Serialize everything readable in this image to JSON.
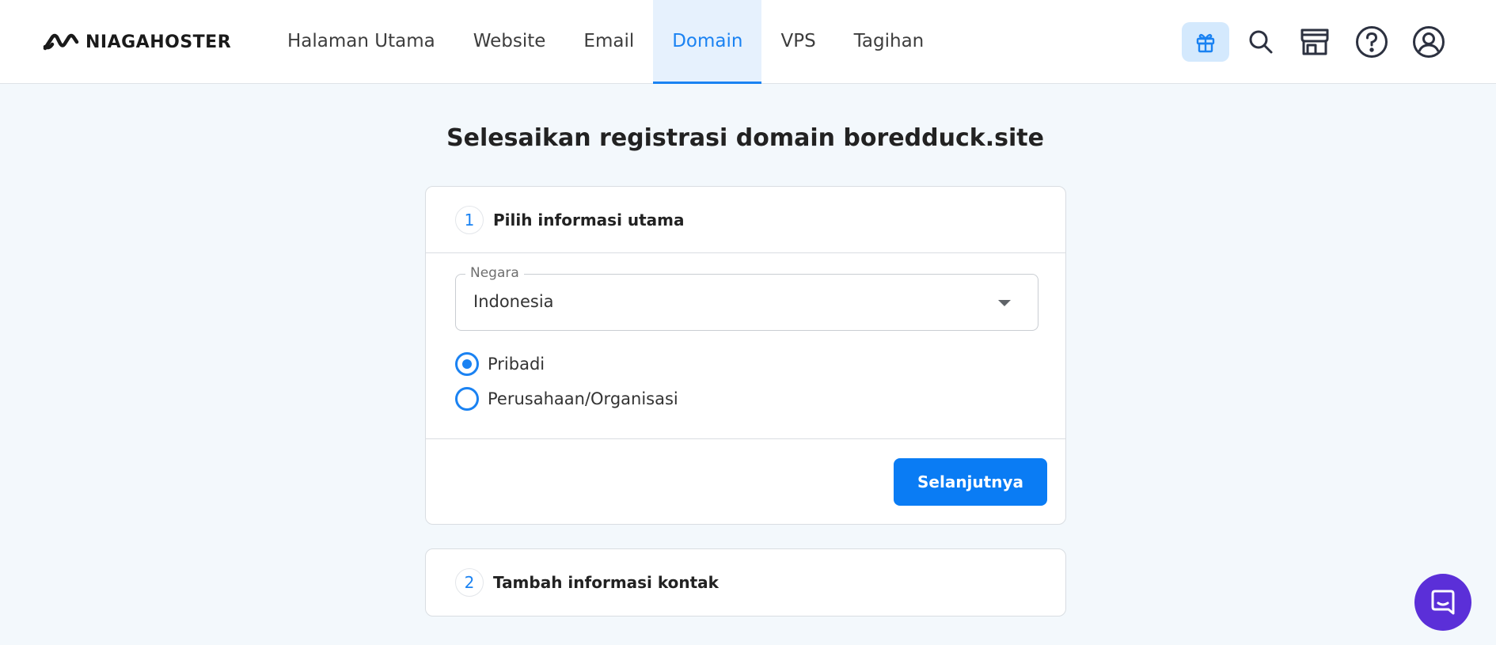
{
  "header": {
    "logo_text": "NIAGAHOSTER",
    "nav": [
      {
        "label": "Halaman Utama",
        "active": false
      },
      {
        "label": "Website",
        "active": false
      },
      {
        "label": "Email",
        "active": false
      },
      {
        "label": "Domain",
        "active": true
      },
      {
        "label": "VPS",
        "active": false
      },
      {
        "label": "Tagihan",
        "active": false
      }
    ],
    "icons": [
      "gift-icon",
      "search-icon",
      "store-icon",
      "help-icon",
      "account-icon"
    ]
  },
  "main": {
    "title": "Selesaikan registrasi domain boredduck.site",
    "step1": {
      "number": "1",
      "title": "Pilih informasi utama",
      "country_label": "Negara",
      "country_value": "Indonesia",
      "options": [
        {
          "label": "Pribadi",
          "selected": true
        },
        {
          "label": "Perusahaan/Organisasi",
          "selected": false
        }
      ],
      "next_label": "Selanjutnya"
    },
    "step2": {
      "number": "2",
      "title": "Tambah informasi kontak"
    }
  },
  "colors": {
    "accent": "#1a82f2",
    "button": "#0a7cf4",
    "chat": "#5b2fd8",
    "background": "#f3f8fc"
  }
}
